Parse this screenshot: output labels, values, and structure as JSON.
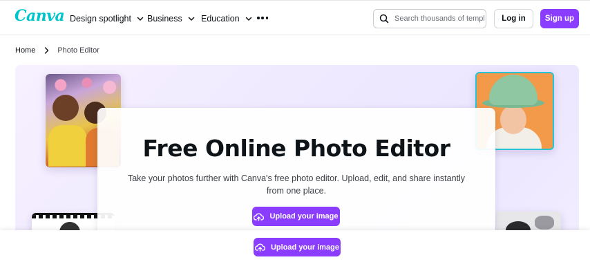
{
  "brand": {
    "logo_text": "Canva",
    "accent": "#8b3dff",
    "logo_color": "#00c4cc"
  },
  "nav": {
    "items": [
      {
        "label": "Design spotlight"
      },
      {
        "label": "Business"
      },
      {
        "label": "Education"
      }
    ],
    "more_icon": "more-horizontal-icon"
  },
  "search": {
    "placeholder": "Search thousands of templates",
    "value": ""
  },
  "auth": {
    "login_label": "Log in",
    "signup_label": "Sign up"
  },
  "breadcrumb": {
    "home": "Home",
    "current": "Photo Editor"
  },
  "hero": {
    "title": "Free Online Photo Editor",
    "description": "Take your photos further with Canva's free photo editor. Upload, edit, and share instantly from one place.",
    "upload_label": "Upload your image"
  },
  "sticky_bar": {
    "upload_label": "Upload your image"
  }
}
